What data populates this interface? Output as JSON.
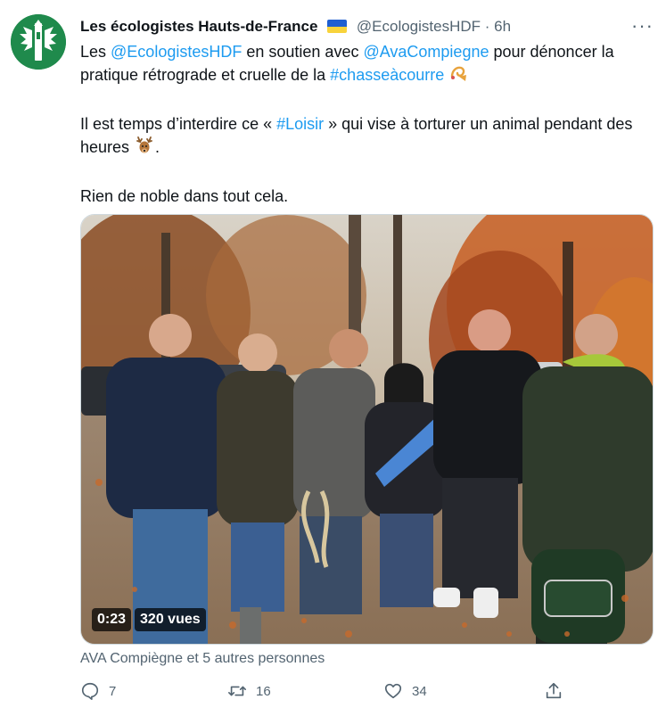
{
  "account": {
    "display_name": "Les écologistes Hauts-de-France",
    "flag_icon": "ukraine-flag-icon",
    "handle": "@EcologistesHDF",
    "separator": "·",
    "time": "6h",
    "avatar_color": "#1f8a4c"
  },
  "more_label": "···",
  "tweet": {
    "p1_before": "Les ",
    "p1_mention1": "@EcologistesHDF",
    "p1_mid": " en soutien avec ",
    "p1_mention2": "@AvaCompiegne",
    "p1_after": " pour dénoncer la pratique rétrograde et cruelle de la ",
    "p1_hashtag": "#chasseàcourre",
    "p1_emoji": "hunting-horn-emoji",
    "p2_before": "Il est temps d’interdire ce « ",
    "p2_hashtag": "#Loisir",
    "p2_after": " » qui vise à torturer un animal pendant des heures ",
    "p2_emoji": "deer-emoji",
    "p2_end": ".",
    "p3": "Rien de noble dans tout cela."
  },
  "video": {
    "duration": "0:23",
    "views": "320 vues"
  },
  "tagged_people": "AVA Compiègne et 5 autres personnes",
  "actions": {
    "reply_count": "7",
    "retweet_count": "16",
    "like_count": "34"
  },
  "colors": {
    "link": "#1d9bf0",
    "muted": "#536471",
    "text": "#0f1419"
  }
}
